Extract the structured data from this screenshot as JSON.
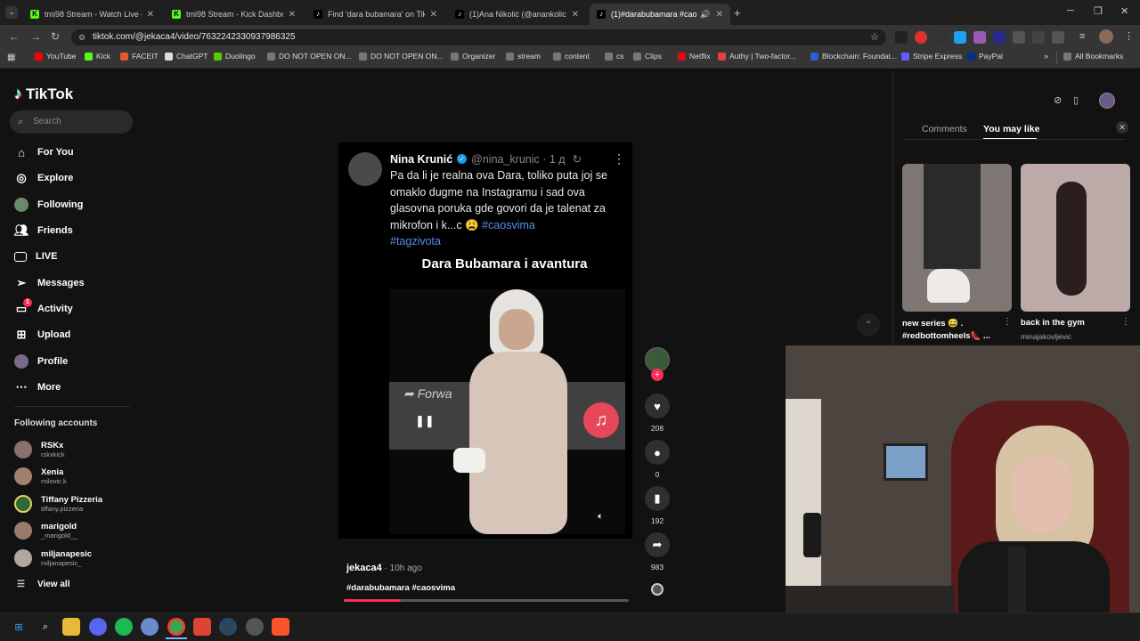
{
  "browser": {
    "tabs": [
      {
        "title": "tmi98 Stream - Watch Live on K",
        "icon": "kick-icon"
      },
      {
        "title": "tmi98 Stream - Kick Dashboard",
        "icon": "kick-icon"
      },
      {
        "title": "Find 'dara bubamara' on TikTok",
        "icon": "tiktok-icon"
      },
      {
        "title": "(1)Ana Nikolić (@anankolicoffi",
        "icon": "tiktok-icon"
      },
      {
        "title": "(1)#darabubamara #caosvi",
        "icon": "tiktok-icon"
      }
    ],
    "url": "tiktok.com/@jekaca4/video/7632242330937986325",
    "bookmarks": [
      "YouTube",
      "Kick",
      "FACEIT",
      "ChatGPT",
      "Duolingo",
      "DO NOT OPEN ON...",
      "DO NOT OPEN ON...",
      "Organizer",
      "stream",
      "content",
      "cs",
      "Clips",
      "Netflix",
      "Authy | Two-factor...",
      "Blockchain: Foundat...",
      "Stripe Express",
      "PayPal"
    ],
    "all_bookmarks": "All Bookmarks"
  },
  "tiktok": {
    "logo": "TikTok",
    "search_placeholder": "Search",
    "nav": [
      "For You",
      "Explore",
      "Following",
      "Friends",
      "LIVE",
      "Messages",
      "Activity",
      "Upload",
      "Profile",
      "More"
    ],
    "activity_badge": "1",
    "following_heading": "Following accounts",
    "accounts": [
      {
        "name": "RSKx",
        "handle": "rskxkick"
      },
      {
        "name": "Xenia",
        "handle": "milovic.k"
      },
      {
        "name": "Tiffany Pizzeria",
        "handle": "tiffany.pizzeria"
      },
      {
        "name": "marigold",
        "handle": "_marigold__"
      },
      {
        "name": "miljanapesic",
        "handle": "miljanapesic_"
      }
    ],
    "view_all": "View all"
  },
  "post": {
    "author_name": "Nina Krunić",
    "author_handle": "@nina_krunic · 1 д",
    "text": "Pa da li je realna ova Dara, toliko puta joj se omaklo dugme na Instagramu i sad ova glasovna poruka gde govori da je talenat za mikrofon i k...c 😩",
    "hashtags_inline": [
      "#caosvima",
      "#tagzivota"
    ],
    "video_title": "Dara Bubamara i avantura",
    "forward_text": "Forwa",
    "uploader": "jekaca4",
    "time_ago": " · 10h ago",
    "tags_line": "#darabubamara #caosvima",
    "counts": {
      "likes": "208",
      "comments": "0",
      "saves": "192",
      "shares": "983"
    },
    "progress": 0.2
  },
  "right_panel": {
    "tabs": [
      "Comments",
      "You may like"
    ],
    "active_tab": "You may like",
    "cards": [
      {
        "title": "new series 😅 . #redbottomheels👠 ..."
      },
      {
        "title": "back in the gym",
        "author": "minajakovljevic"
      }
    ]
  }
}
